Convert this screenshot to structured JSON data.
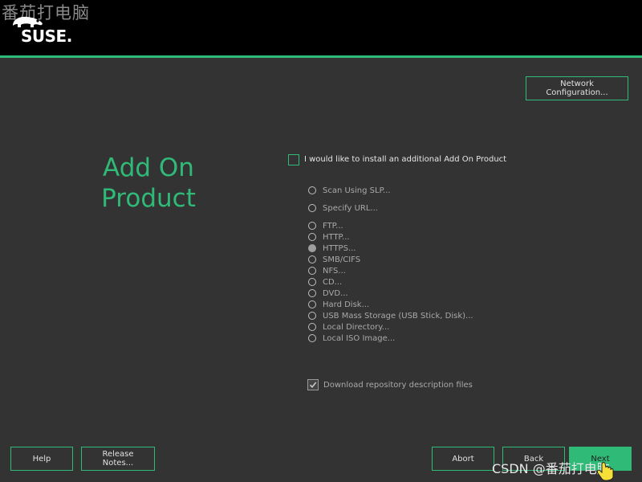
{
  "watermark_top": "番茄打电脑",
  "watermark_bottom": "CSDN @番茄打电脑",
  "logo_text": "SUSE.",
  "header": {
    "network_button": "Network Configuration..."
  },
  "main": {
    "title_line1": "Add On",
    "title_line2": "Product",
    "addon_checkbox_label": "I would like to install an additional Add On Product",
    "addon_checked": false,
    "sources": [
      {
        "label": "Scan Using SLP...",
        "selected": false
      },
      {
        "label": "Specify URL...",
        "selected": false
      },
      {
        "label": "FTP...",
        "selected": false
      },
      {
        "label": "HTTP...",
        "selected": false
      },
      {
        "label": "HTTPS...",
        "selected": true
      },
      {
        "label": "SMB/CIFS",
        "selected": false
      },
      {
        "label": "NFS...",
        "selected": false
      },
      {
        "label": "CD...",
        "selected": false
      },
      {
        "label": "DVD...",
        "selected": false
      },
      {
        "label": "Hard Disk...",
        "selected": false
      },
      {
        "label": "USB Mass Storage (USB Stick, Disk)...",
        "selected": false
      },
      {
        "label": "Local Directory...",
        "selected": false
      },
      {
        "label": "Local ISO Image...",
        "selected": false
      }
    ],
    "download_label": "Download repository description files",
    "download_checked": true
  },
  "footer": {
    "help": "Help",
    "release_notes": "Release Notes...",
    "abort": "Abort",
    "back": "Back",
    "next": "Next"
  },
  "colors": {
    "accent": "#30ba78",
    "background": "#333333",
    "topbar": "#000000"
  }
}
